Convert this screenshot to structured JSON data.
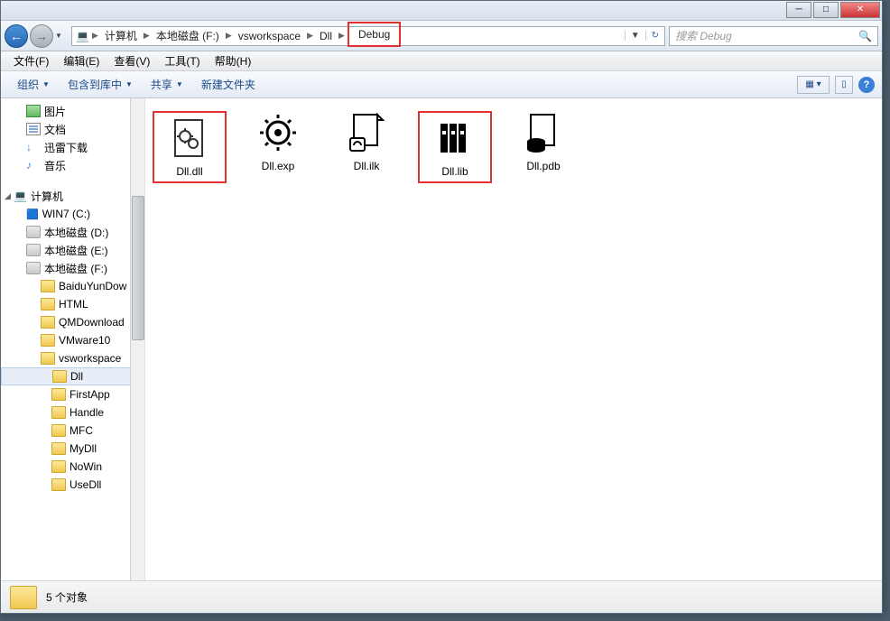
{
  "titlebar": {},
  "nav": {
    "breadcrumb": [
      "计算机",
      "本地磁盘 (F:)",
      "vsworkspace",
      "Dll",
      "Debug"
    ],
    "search_placeholder": "搜索 Debug"
  },
  "menubar": [
    "文件(F)",
    "编辑(E)",
    "查看(V)",
    "工具(T)",
    "帮助(H)"
  ],
  "toolbar": {
    "organize": "组织",
    "include": "包含到库中",
    "share": "共享",
    "newfolder": "新建文件夹"
  },
  "sidebar": {
    "libs": [
      {
        "label": "图片",
        "icon": "pic"
      },
      {
        "label": "文档",
        "icon": "doc"
      },
      {
        "label": "迅雷下载",
        "icon": "dl"
      },
      {
        "label": "音乐",
        "icon": "music"
      }
    ],
    "computer": "计算机",
    "drives": [
      {
        "label": "WIN7 (C:)",
        "icon": "win"
      },
      {
        "label": "本地磁盘 (D:)",
        "icon": "drv"
      },
      {
        "label": "本地磁盘 (E:)",
        "icon": "drv"
      },
      {
        "label": "本地磁盘 (F:)",
        "icon": "drv",
        "expanded": true
      }
    ],
    "f_folders": [
      "BaiduYunDow",
      "HTML",
      "QMDownload",
      "VMware10",
      "vsworkspace"
    ],
    "vs_folders": [
      "Dll",
      "FirstApp",
      "Handle",
      "MFC",
      "MyDll",
      "NoWin",
      "UseDll"
    ],
    "selected": "Dll"
  },
  "files": [
    {
      "name": "Dll.dll",
      "type": "dll",
      "highlight": true
    },
    {
      "name": "Dll.exp",
      "type": "exp"
    },
    {
      "name": "Dll.ilk",
      "type": "ilk"
    },
    {
      "name": "Dll.lib",
      "type": "lib",
      "highlight": true
    },
    {
      "name": "Dll.pdb",
      "type": "pdb"
    }
  ],
  "status": {
    "count": "5 个对象"
  }
}
